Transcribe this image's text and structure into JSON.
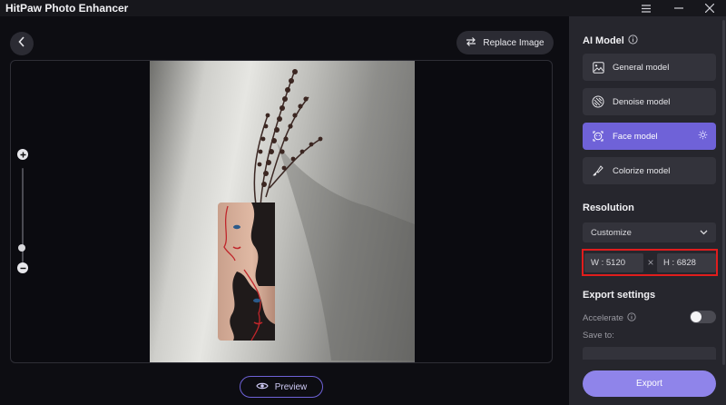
{
  "app": {
    "title": "HitPaw Photo Enhancer"
  },
  "toolbar": {
    "replace_label": "Replace Image"
  },
  "preview": {
    "label": "Preview"
  },
  "panel": {
    "ai_model_title": "AI Model",
    "models": [
      {
        "label": "General model",
        "icon": "image-icon",
        "active": false
      },
      {
        "label": "Denoise model",
        "icon": "denoise-icon",
        "active": false
      },
      {
        "label": "Face model",
        "icon": "face-icon",
        "active": true
      },
      {
        "label": "Colorize model",
        "icon": "brush-icon",
        "active": false
      }
    ],
    "resolution_title": "Resolution",
    "resolution_select": "Customize",
    "width": "W : 5120",
    "height": "H : 6828",
    "dims_separator": "×",
    "export_title": "Export settings",
    "accelerate_label": "Accelerate",
    "accelerate_on": false,
    "save_to_label": "Save to:",
    "export_label": "Export"
  },
  "zoom": {
    "level": 0.1
  },
  "colors": {
    "accent": "#6f62d8",
    "export": "#8f84ea",
    "highlight": "#e01d1d"
  }
}
